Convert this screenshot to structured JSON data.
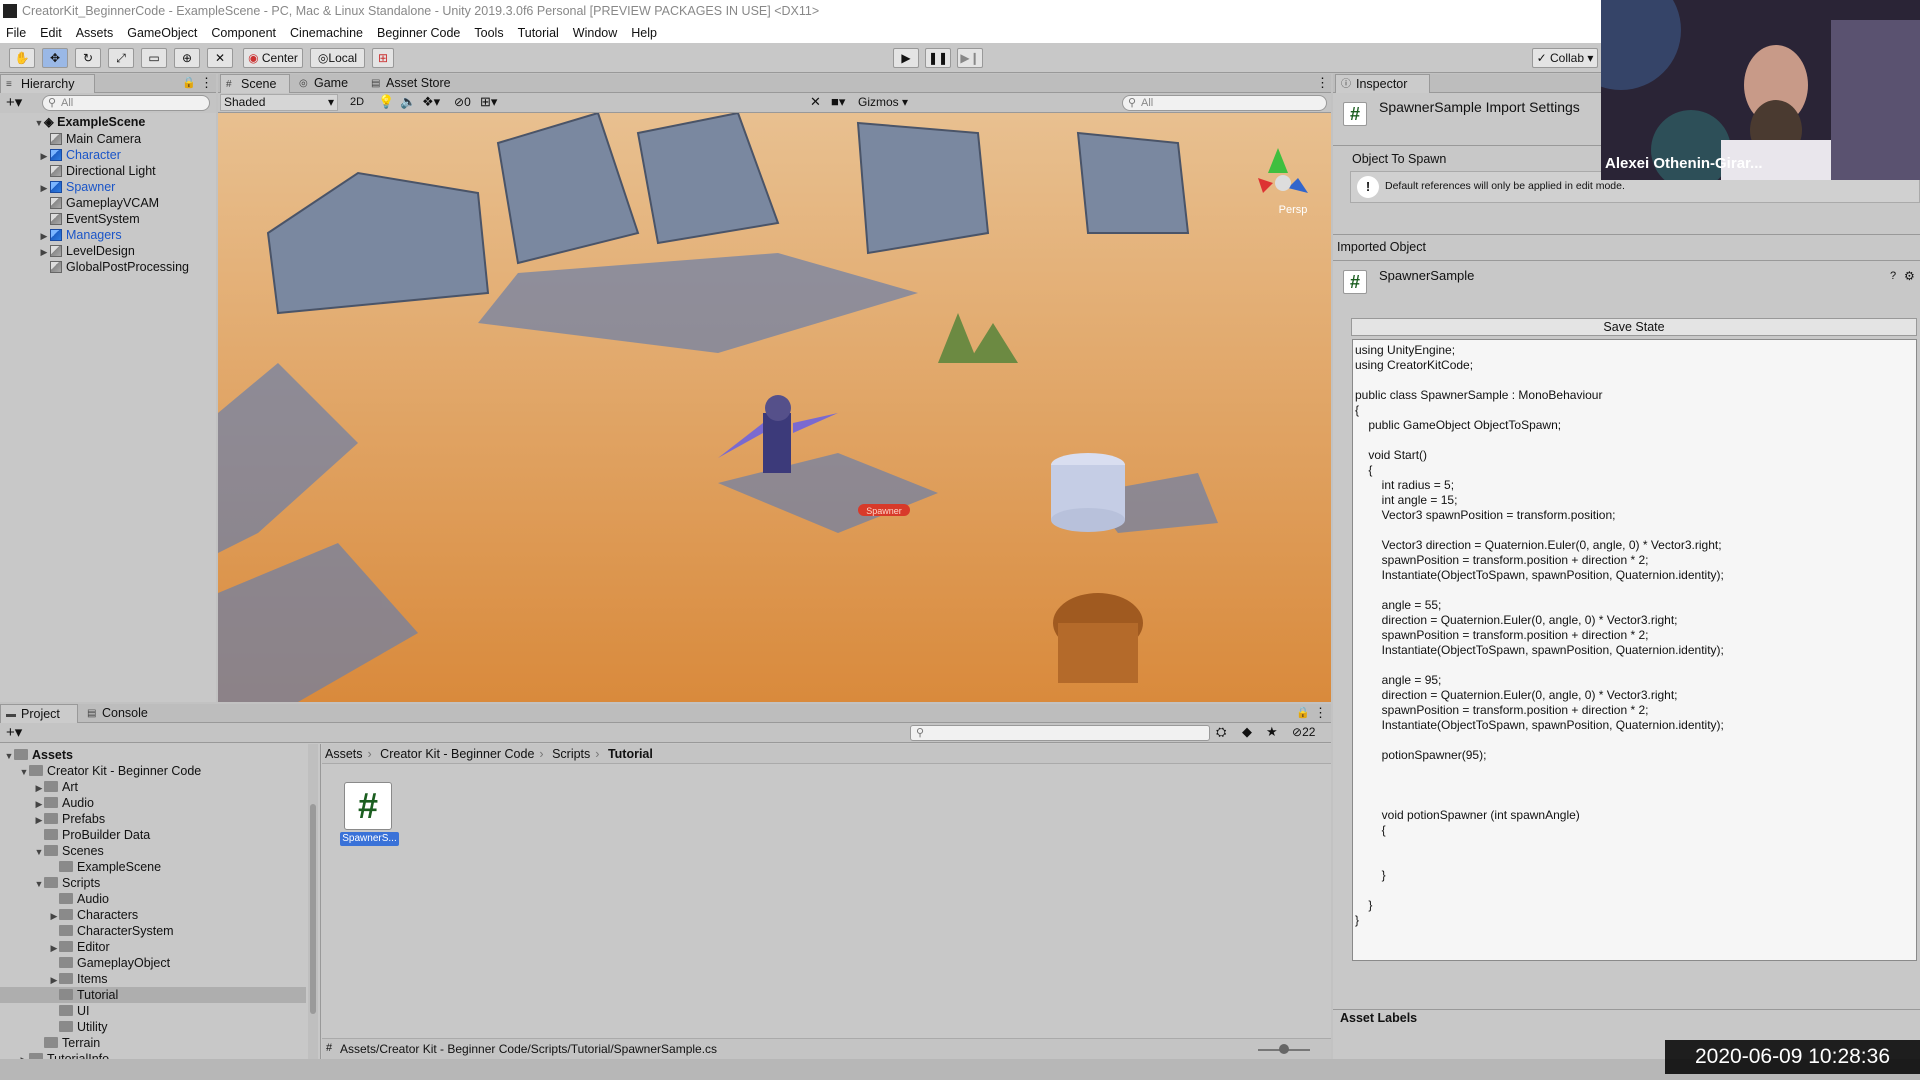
{
  "window_title": "CreatorKit_BeginnerCode - ExampleScene - PC, Mac & Linux Standalone - Unity 2019.3.0f6 Personal [PREVIEW PACKAGES IN USE] <DX11>",
  "menu": [
    "File",
    "Edit",
    "Assets",
    "GameObject",
    "Component",
    "Cinemachine",
    "Beginner Code",
    "Tools",
    "Tutorial",
    "Window",
    "Help"
  ],
  "toolbar": {
    "center_label": "Center",
    "local_label": "Local",
    "collab_label": "Collab"
  },
  "hierarchy": {
    "tab": "Hierarchy",
    "search_placeholder": "All",
    "scene": "ExampleScene",
    "items": [
      {
        "label": "Main Camera",
        "color": "#111111"
      },
      {
        "label": "Character",
        "color": "#1a55c8"
      },
      {
        "label": "Directional Light",
        "color": "#111111"
      },
      {
        "label": "Spawner",
        "color": "#1a55c8"
      },
      {
        "label": "GameplayVCAM",
        "color": "#111111"
      },
      {
        "label": "EventSystem",
        "color": "#111111"
      },
      {
        "label": "Managers",
        "color": "#1a55c8"
      },
      {
        "label": "LevelDesign",
        "color": "#111111"
      },
      {
        "label": "GlobalPostProcessing",
        "color": "#111111"
      }
    ]
  },
  "scene_tabs": {
    "scene": "Scene",
    "game": "Game",
    "asset_store": "Asset Store"
  },
  "scene_toolbar": {
    "shading": "Shaded",
    "mode_2d": "2D",
    "hidden_count": "0",
    "gizmos": "Gizmos",
    "search_placeholder": "All",
    "persp": "Persp",
    "spawner_tag": "Spawner"
  },
  "inspector": {
    "tab": "Inspector",
    "header": "SpawnerSample Import Settings",
    "field_label": "Object To Spawn",
    "help_text": "Default references will only be applied in edit mode.",
    "imported_object": "Imported Object",
    "object_name": "SpawnerSample",
    "save_state": "Save State",
    "code": "using UnityEngine;\nusing CreatorKitCode;\n\npublic class SpawnerSample : MonoBehaviour\n{\n    public GameObject ObjectToSpawn;\n\n    void Start()\n    {\n        int radius = 5;\n        int angle = 15;\n        Vector3 spawnPosition = transform.position;\n\n        Vector3 direction = Quaternion.Euler(0, angle, 0) * Vector3.right;\n        spawnPosition = transform.position + direction * 2;\n        Instantiate(ObjectToSpawn, spawnPosition, Quaternion.identity);\n\n        angle = 55;\n        direction = Quaternion.Euler(0, angle, 0) * Vector3.right;\n        spawnPosition = transform.position + direction * 2;\n        Instantiate(ObjectToSpawn, spawnPosition, Quaternion.identity);\n\n        angle = 95;\n        direction = Quaternion.Euler(0, angle, 0) * Vector3.right;\n        spawnPosition = transform.position + direction * 2;\n        Instantiate(ObjectToSpawn, spawnPosition, Quaternion.identity);\n\n        potionSpawner(95);\n\n\n\n        void potionSpawner (int spawnAngle)\n        {\n\n\n        }\n\n    }\n}",
    "asset_labels": "Asset Labels"
  },
  "project": {
    "tab": "Project",
    "console_tab": "Console",
    "hidden_count": "22",
    "tree": [
      {
        "label": "Assets",
        "indent": 0,
        "arrow": "▼",
        "bold": true
      },
      {
        "label": "Creator Kit - Beginner Code",
        "indent": 1,
        "arrow": "▼"
      },
      {
        "label": "Art",
        "indent": 2,
        "arrow": "▶"
      },
      {
        "label": "Audio",
        "indent": 2,
        "arrow": "▶"
      },
      {
        "label": "Prefabs",
        "indent": 2,
        "arrow": "▶"
      },
      {
        "label": "ProBuilder Data",
        "indent": 2,
        "arrow": ""
      },
      {
        "label": "Scenes",
        "indent": 2,
        "arrow": "▼"
      },
      {
        "label": "ExampleScene",
        "indent": 3,
        "arrow": ""
      },
      {
        "label": "Scripts",
        "indent": 2,
        "arrow": "▼"
      },
      {
        "label": "Audio",
        "indent": 3,
        "arrow": ""
      },
      {
        "label": "Characters",
        "indent": 3,
        "arrow": "▶"
      },
      {
        "label": "CharacterSystem",
        "indent": 3,
        "arrow": ""
      },
      {
        "label": "Editor",
        "indent": 3,
        "arrow": "▶"
      },
      {
        "label": "GameplayObject",
        "indent": 3,
        "arrow": ""
      },
      {
        "label": "Items",
        "indent": 3,
        "arrow": "▶"
      },
      {
        "label": "Tutorial",
        "indent": 3,
        "arrow": "",
        "selected": true
      },
      {
        "label": "UI",
        "indent": 3,
        "arrow": ""
      },
      {
        "label": "Utility",
        "indent": 3,
        "arrow": ""
      },
      {
        "label": "Terrain",
        "indent": 2,
        "arrow": ""
      },
      {
        "label": "TutorialInfo",
        "indent": 1,
        "arrow": "▶"
      }
    ],
    "breadcrumb": [
      "Assets",
      "Creator Kit - Beginner Code",
      "Scripts",
      "Tutorial"
    ],
    "asset_name": "SpawnerS...",
    "status_path": "Assets/Creator Kit - Beginner Code/Scripts/Tutorial/SpawnerSample.cs",
    "slider_value": 0.5
  },
  "webcam": {
    "name": "Alexei Othenin-Girar..."
  },
  "timestamp": "2020-06-09 10:28:36"
}
